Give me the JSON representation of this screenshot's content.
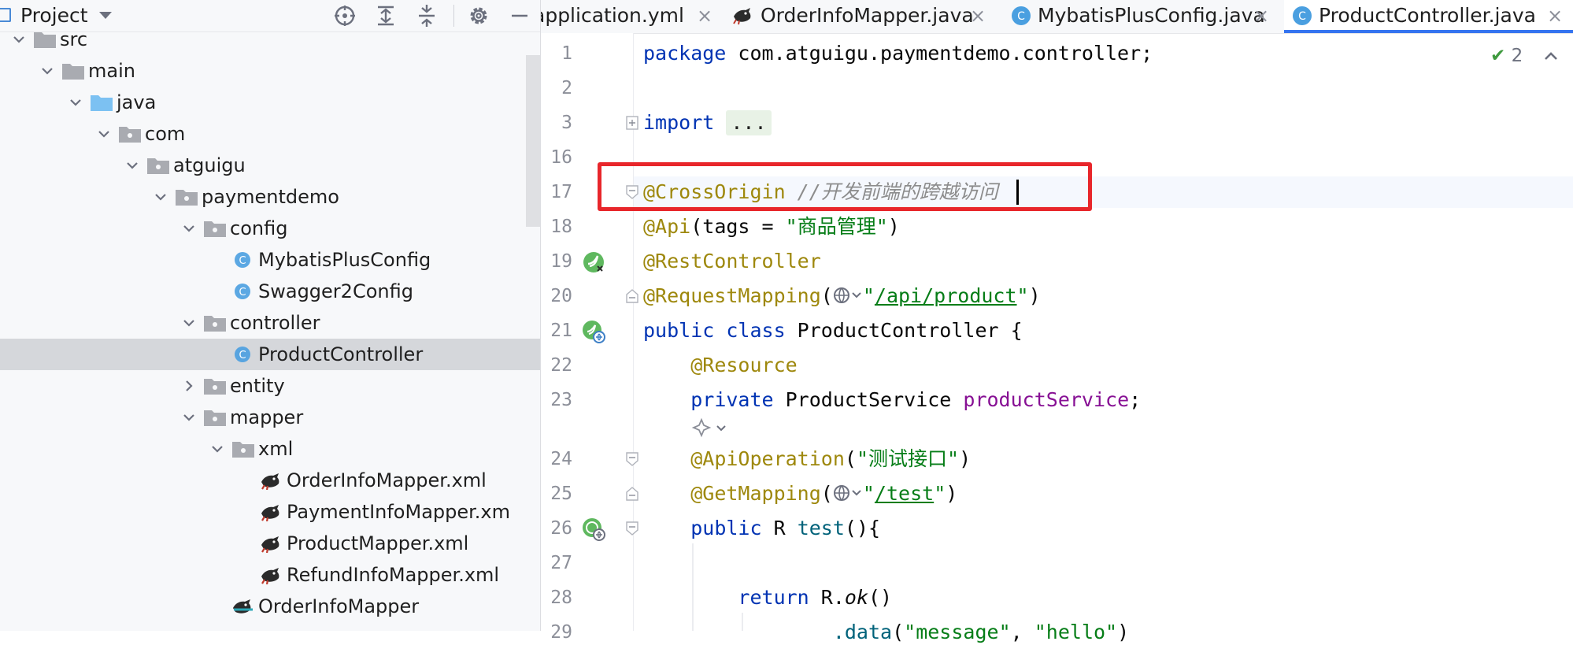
{
  "project_panel": {
    "title": "Project",
    "tree": [
      {
        "label": "src",
        "depth": 0,
        "expanded": true,
        "kind": "folder"
      },
      {
        "label": "main",
        "depth": 1,
        "expanded": true,
        "kind": "folder"
      },
      {
        "label": "java",
        "depth": 2,
        "expanded": true,
        "kind": "source-folder"
      },
      {
        "label": "com",
        "depth": 3,
        "expanded": true,
        "kind": "package"
      },
      {
        "label": "atguigu",
        "depth": 4,
        "expanded": true,
        "kind": "package"
      },
      {
        "label": "paymentdemo",
        "depth": 5,
        "expanded": true,
        "kind": "package"
      },
      {
        "label": "config",
        "depth": 6,
        "expanded": true,
        "kind": "package"
      },
      {
        "label": "MybatisPlusConfig",
        "depth": 7,
        "kind": "class"
      },
      {
        "label": "Swagger2Config",
        "depth": 7,
        "kind": "class"
      },
      {
        "label": "controller",
        "depth": 6,
        "expanded": true,
        "kind": "package"
      },
      {
        "label": "ProductController",
        "depth": 7,
        "kind": "class",
        "selected": true
      },
      {
        "label": "entity",
        "depth": 6,
        "expanded": false,
        "kind": "package"
      },
      {
        "label": "mapper",
        "depth": 6,
        "expanded": true,
        "kind": "package"
      },
      {
        "label": "xml",
        "depth": 7,
        "expanded": true,
        "kind": "package"
      },
      {
        "label": "OrderInfoMapper.xml",
        "depth": 8,
        "kind": "mybatis-xml"
      },
      {
        "label": "PaymentInfoMapper.xm",
        "depth": 8,
        "kind": "mybatis-xml"
      },
      {
        "label": "ProductMapper.xml",
        "depth": 8,
        "kind": "mybatis-xml"
      },
      {
        "label": "RefundInfoMapper.xml",
        "depth": 8,
        "kind": "mybatis-xml"
      },
      {
        "label": "OrderInfoMapper",
        "depth": 7,
        "kind": "mybatis-mapper"
      }
    ]
  },
  "tabs": [
    {
      "label": "application.yml",
      "icon": "yaml-icon",
      "active": false
    },
    {
      "label": "OrderInfoMapper.java",
      "icon": "mybatis-bird-icon",
      "active": false
    },
    {
      "label": "MybatisPlusConfig.java",
      "icon": "class-icon",
      "active": false
    },
    {
      "label": "ProductController.java",
      "icon": "class-icon",
      "active": true
    }
  ],
  "tab_close_glyph": "×",
  "inspection": {
    "count": "2"
  },
  "editor": {
    "line_numbers": [
      "1",
      "2",
      "3",
      "16",
      "17",
      "18",
      "19",
      "20",
      "21",
      "22",
      "23",
      "24",
      "25",
      "26",
      "27",
      "28",
      "29"
    ],
    "line1": {
      "kw": "package",
      "rest": " com.atguigu.paymentdemo.controller;"
    },
    "line3": {
      "kw": "import",
      "chip": "..."
    },
    "line17": {
      "ann": "@CrossOrigin",
      "cmt": " //开发前端的跨越访问"
    },
    "line18": {
      "ann": "@Api",
      "p1": "(tags = ",
      "str": "\"商品管理\"",
      "p2": ")"
    },
    "line19": {
      "ann": "@RestController"
    },
    "line20": {
      "ann": "@RequestMapping",
      "p1": "(",
      "q1": "\"",
      "url": "/api/product",
      "q2": "\"",
      "p2": ")"
    },
    "line21": {
      "kw1": "public",
      "kw2": " class",
      "rest": " ProductController {"
    },
    "line22": {
      "ann": "@Resource"
    },
    "line23": {
      "kw": "private",
      "type": " ProductService ",
      "fld": "productService",
      "end": ";"
    },
    "line24": {
      "ann": "@ApiOperation",
      "p1": "(",
      "str": "\"测试接口\"",
      "p2": ")"
    },
    "line25": {
      "ann": "@GetMapping",
      "p1": "(",
      "q1": "\"",
      "url": "/test",
      "q2": "\"",
      "p2": ")"
    },
    "line26": {
      "kw": "public",
      "type": " R ",
      "fn": "test",
      "end": "(){"
    },
    "line28": {
      "kw": "return",
      "rest": " R.",
      "it": "ok",
      "end": "()"
    },
    "line29": {
      "fn": ".data",
      "p1": "(",
      "s1": "\"message\"",
      "comma": ", ",
      "s2": "\"hello\"",
      "p2": ")"
    }
  },
  "colors": {
    "keyword": "#0033b3",
    "annotation": "#9e880d",
    "string": "#067d17",
    "field": "#871094",
    "comment": "#8c8c8c",
    "highlight_box": "#e8262b",
    "active_tab_bar": "#3574f0",
    "selected_row": "#d5d7db"
  }
}
